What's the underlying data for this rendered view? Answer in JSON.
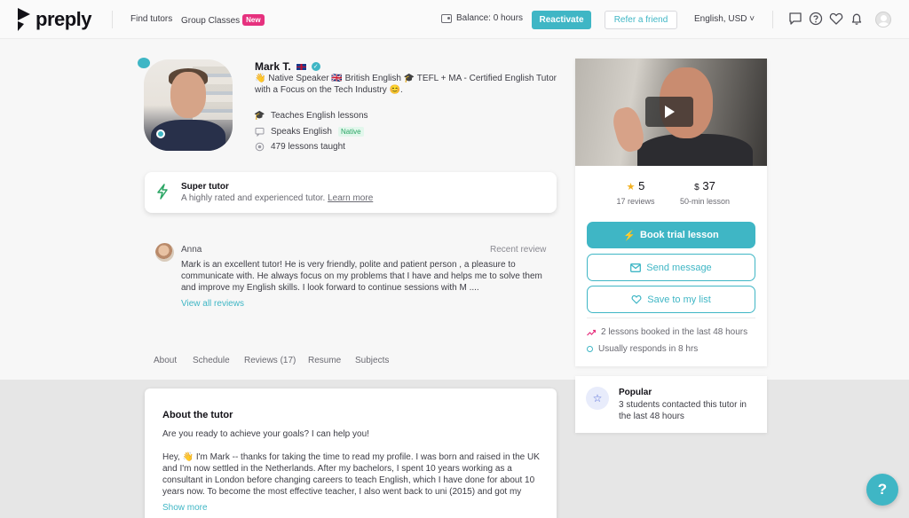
{
  "header": {
    "logo_text": "preply",
    "nav": {
      "find_tutors": "Find tutors",
      "group_classes": "Group Classes",
      "new_badge": "New"
    },
    "balance": "Balance: 0 hours",
    "reactivate": "Reactivate",
    "refer": "Refer a friend",
    "language": "English, USD ˅",
    "icons": [
      "chat-icon",
      "help-icon",
      "heart-icon",
      "bell-icon",
      "avatar"
    ]
  },
  "tutor": {
    "name": "Mark T.",
    "headline_1": "👋 Native Speaker 🇬🇧 British English 🎓 TEFL + MA - Certified English Tutor",
    "headline_2": "with a Focus on the Tech Industry 😊.",
    "teaches": "Teaches English lessons",
    "speaks": "Speaks English",
    "native_tag": "Native",
    "lessons": "479 lessons taught"
  },
  "super_tutor": {
    "title": "Super tutor",
    "text": "A highly rated and experienced tutor.",
    "link": "Learn more"
  },
  "review": {
    "name": "Anna",
    "tag": "Recent review",
    "text": "Mark is an excellent tutor! He is very friendly, polite and patient person , a pleasure to communicate with. He always focus on my problems that I have and helps me to solve them and improve my English skills. I look forward to continue sessions with M ....",
    "view_all": "View all reviews"
  },
  "tabs": [
    "About",
    "Schedule",
    "Reviews (17)",
    "Resume",
    "Subjects"
  ],
  "about": {
    "title": "About the tutor",
    "lead": "Are you ready to achieve your goals? I can help you!",
    "body": "Hey, 👋 I'm Mark -- thanks for taking the time to read my profile. I was born and raised in the UK and I'm now settled in the Netherlands. After my bachelors, I spent 10 years working as a consultant in London before changing careers to teach English, which I have done for about 10 years now. To become the most effective teacher, I also went back to uni (2015) and got my",
    "show_more": "Show more"
  },
  "side": {
    "rating": "5",
    "reviews": "17 reviews",
    "currency": "$",
    "price": "37",
    "price_label": "50-min lesson",
    "book": "Book trial lesson",
    "message": "Send message",
    "save": "Save to my list",
    "booked": "2 lessons booked in the last 48 hours",
    "responds": "Usually responds in 8 hrs"
  },
  "popular": {
    "title": "Popular",
    "text": "3 students contacted this tutor in the last 48 hours"
  },
  "help_fab": "?",
  "colors": {
    "accent": "#3fb6c5",
    "new_badge": "#e6317e",
    "native": "#2aa564",
    "star": "#f2b01e"
  }
}
